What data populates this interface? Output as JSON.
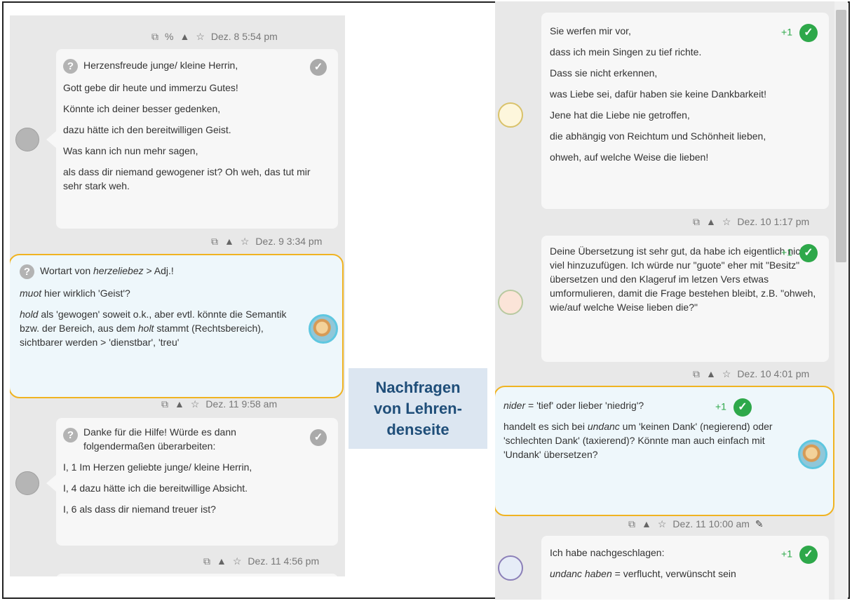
{
  "left_column": {
    "top_meta": {
      "timestamp": "Dez. 8 5:54 pm"
    },
    "post1": {
      "title": "Herzensfreude junge/ kleine Herrin,",
      "lines": [
        "Gott gebe dir heute und immerzu Gutes!",
        "Könnte ich deiner besser gedenken,",
        "dazu hätte ich den bereitwilligen Geist.",
        "Was kann ich nun mehr sagen,",
        "als dass dir niemand gewogener ist? Oh weh, das tut mir sehr stark weh."
      ],
      "timestamp": "Dez. 9 3:34 pm"
    },
    "teacher_note": {
      "line1_prefix": "Wortart von ",
      "line1_em": "herzeliebez",
      "line1_suffix": " > Adj.!",
      "line2_em": "muot",
      "line2_suffix": " hier wirklich 'Geist'?",
      "line3_em1": "hold",
      "line3_mid": " als 'gewogen' soweit o.k., aber evtl. könnte die Semantik bzw. der Bereich, aus dem ",
      "line3_em2": "holt",
      "line3_suffix": " stammt (Rechtsbereich), sichtbarer werden > 'dienstbar', 'treu'",
      "timestamp": "Dez. 11 9:58 am"
    },
    "post2": {
      "title": "Danke für die Hilfe! Würde es dann folgendermaßen überarbeiten:",
      "lines": [
        "I, 1 Im Herzen geliebte junge/ kleine Herrin,",
        "I, 4 dazu hätte ich die bereitwillige Absicht.",
        "I, 6 als dass dir niemand treuer ist?"
      ],
      "timestamp": "Dez. 11 4:56 pm"
    }
  },
  "center_label": {
    "line1": "Nachfragen",
    "line2": "von Lehren-",
    "line3": "denseite"
  },
  "right_column": {
    "post1": {
      "lines": [
        "Sie werfen mir vor,",
        "dass ich mein Singen zu tief richte.",
        "Dass sie nicht erkennen,",
        "was Liebe sei, dafür haben sie keine Dankbarkeit!",
        "Jene hat die Liebe nie getroffen,",
        "die abhängig von Reichtum und Schönheit lieben,",
        "ohweh, auf welche Weise die lieben!"
      ],
      "vote": "+1",
      "timestamp": "Dez. 10 1:17 pm"
    },
    "post2": {
      "text": "Deine Übersetzung ist sehr gut, da habe ich eigentlich nicht viel hinzuzufügen. Ich würde nur \"guote\" eher mit \"Besitz\" übersetzen und den Klageruf im letzen Vers etwas umformulieren, damit die Frage bestehen bleibt, z.B. \"ohweh, wie/auf welche Weise lieben die?\"",
      "vote": "+1",
      "timestamp": "Dez. 10 4:01 pm"
    },
    "teacher_note": {
      "line1_em": "nider",
      "line1_suffix": " = 'tief' oder lieber 'niedrig'?",
      "line2_prefix": "handelt es sich bei ",
      "line2_em": "undanc",
      "line2_suffix": " um 'keinen Dank' (negierend) oder 'schlechten Dank' (taxierend)? Könnte man auch einfach mit 'Undank' übersetzen?",
      "vote": "+1",
      "timestamp": "Dez. 11 10:00 am"
    },
    "post3": {
      "line1": "Ich habe nachgeschlagen:",
      "line2_em": "undanc haben",
      "line2_suffix": " = verflucht, verwünscht sein",
      "vote": "+1"
    }
  },
  "colors": {
    "teacher_border": "#f0b321",
    "check_green": "#2ea84a",
    "label_bg": "#dce6f1",
    "label_text": "#1f4e79"
  },
  "icons": [
    "copy-icon",
    "link-icon",
    "warning-icon",
    "star-icon",
    "edit-icon",
    "question-icon",
    "check-icon"
  ]
}
